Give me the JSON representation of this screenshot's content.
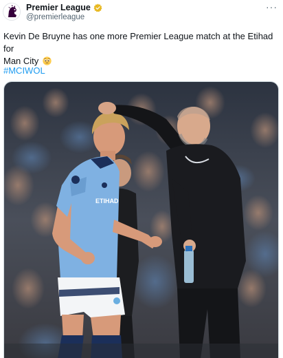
{
  "account": {
    "display_name": "Premier League",
    "handle": "@premierleague",
    "verified": true,
    "avatar_icon": "premier-league-lion-logo"
  },
  "menu": {
    "more_label": "···"
  },
  "tweet": {
    "text_line1": "Kevin De Bruyne has one more Premier League match at the Etihad for",
    "text_line2": "Man City",
    "emoji": "pleading-face",
    "hashtag": "#MCIWOL"
  },
  "media": {
    "description_icon": "photo",
    "jersey_text": "ETIHAD",
    "colors": {
      "sky_blue": "#7fb1e2",
      "dark_kit": "#1c1d20",
      "crowd_bg": "#3a3f4a"
    }
  },
  "colors": {
    "link": "#1d9bf0",
    "secondary_text": "#536471",
    "verified_gold": "#e8b923"
  }
}
